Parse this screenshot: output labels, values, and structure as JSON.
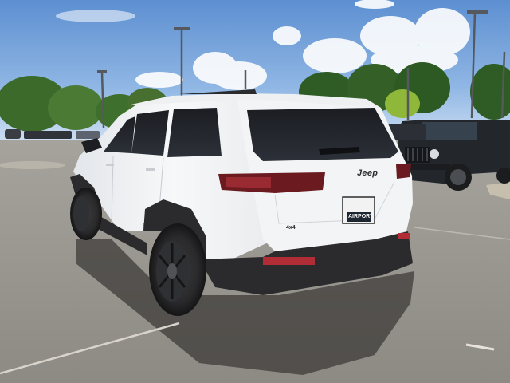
{
  "photo": {
    "subject": "white SUV rear three-quarter view in dealership parking lot",
    "vehicle": {
      "badge_text": "Jeep",
      "drivetrain_badge": "4x4",
      "plate_text": "AIRPORT",
      "body_color": "#f2f3f4",
      "trim_color": "#2b2b2d"
    },
    "sky_color": "#6f9fd8",
    "pavement_color": "#9a9791",
    "foliage_color": "#3f6b2c"
  }
}
